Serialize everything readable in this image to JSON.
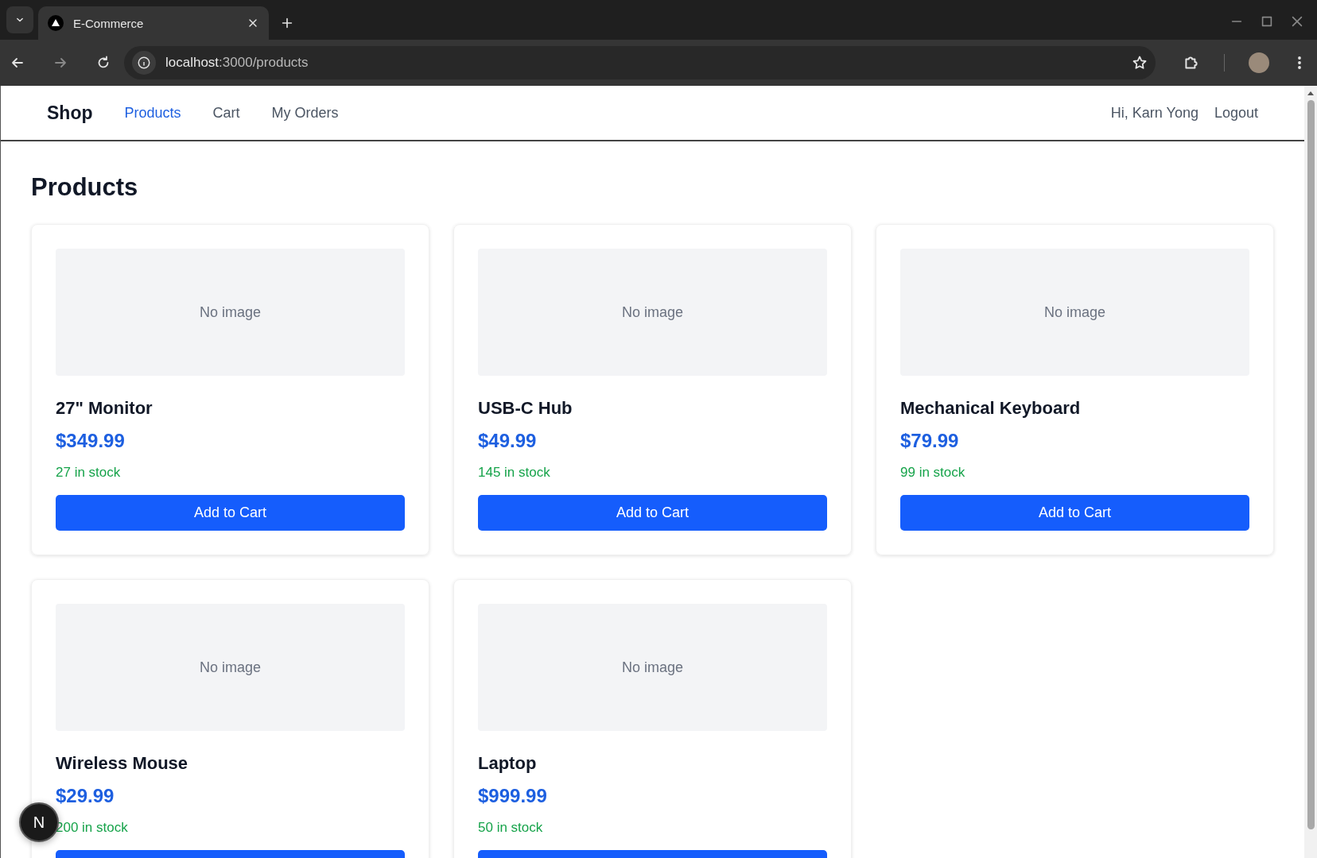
{
  "browser": {
    "tab_title": "E-Commerce",
    "url_host": "localhost",
    "url_path": ":3000/products"
  },
  "nav": {
    "brand": "Shop",
    "links": [
      {
        "label": "Products",
        "selected": true
      },
      {
        "label": "Cart",
        "selected": false
      },
      {
        "label": "My Orders",
        "selected": false
      }
    ],
    "greeting": "Hi, Karn Yong",
    "logout": "Logout"
  },
  "page_title": "Products",
  "products": [
    {
      "image_placeholder": "No image",
      "name": "27\" Monitor",
      "price": "$349.99",
      "stock": "27 in stock",
      "button": "Add to Cart"
    },
    {
      "image_placeholder": "No image",
      "name": "USB-C Hub",
      "price": "$49.99",
      "stock": "145 in stock",
      "button": "Add to Cart"
    },
    {
      "image_placeholder": "No image",
      "name": "Mechanical Keyboard",
      "price": "$79.99",
      "stock": "99 in stock",
      "button": "Add to Cart"
    },
    {
      "image_placeholder": "No image",
      "name": "Wireless Mouse",
      "price": "$29.99",
      "stock": "200 in stock"
    },
    {
      "image_placeholder": "No image",
      "name": "Laptop",
      "price": "$999.99",
      "stock": "50 in stock"
    }
  ],
  "dev_badge": "N"
}
